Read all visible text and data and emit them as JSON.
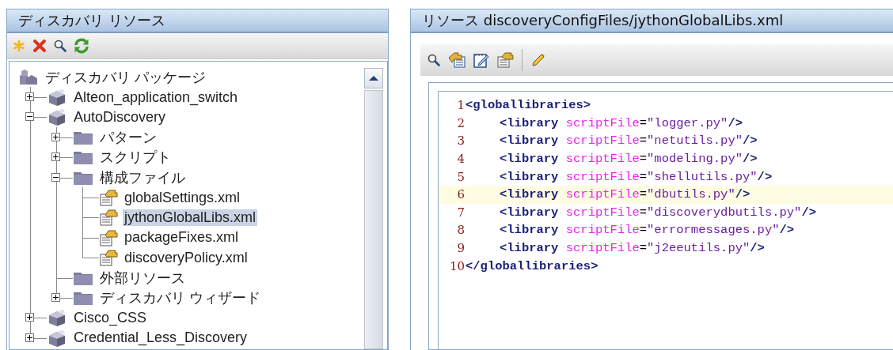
{
  "left_panel": {
    "title": "ディスカバリ リソース",
    "toolbar": [
      {
        "kind": "new"
      },
      {
        "kind": "delete"
      },
      {
        "kind": "search"
      },
      {
        "kind": "refresh"
      }
    ],
    "tree": [
      {
        "label": "ディスカバリ パッケージ",
        "kind": "root",
        "selected": false,
        "children": [
          {
            "label": "Alteon_application_switch",
            "kind": "package",
            "selected": false,
            "expanded": false
          },
          {
            "label": "AutoDiscovery",
            "kind": "package",
            "selected": false,
            "expanded": true,
            "children": [
              {
                "label": "パターン",
                "kind": "folder",
                "selected": false,
                "expanded": false
              },
              {
                "label": "スクリプト",
                "kind": "folder",
                "selected": false,
                "expanded": false
              },
              {
                "label": "構成ファイル",
                "kind": "folder",
                "selected": false,
                "expanded": true,
                "children": [
                  {
                    "label": "globalSettings.xml",
                    "kind": "file",
                    "selected": false
                  },
                  {
                    "label": "jythonGlobalLibs.xml",
                    "kind": "file",
                    "selected": true
                  },
                  {
                    "label": "packageFixes.xml",
                    "kind": "file",
                    "selected": false
                  },
                  {
                    "label": "discoveryPolicy.xml",
                    "kind": "file",
                    "selected": false
                  }
                ]
              },
              {
                "label": "外部リソース",
                "kind": "folder",
                "selected": false
              },
              {
                "label": "ディスカバリ ウィザード",
                "kind": "folder",
                "selected": false,
                "expanded": false
              }
            ]
          },
          {
            "label": "Cisco_CSS",
            "kind": "package",
            "selected": false,
            "expanded": false
          },
          {
            "label": "Credential_Less_Discovery",
            "kind": "package",
            "selected": false,
            "expanded": false
          }
        ]
      }
    ]
  },
  "right_panel": {
    "title": "リソース discoveryConfigFiles/jythonGlobalLibs.xml",
    "toolbar": [
      {
        "kind": "search"
      },
      {
        "kind": "folder-hand"
      },
      {
        "kind": "notepad"
      },
      {
        "kind": "doc-hand"
      },
      {
        "kind": "separator"
      },
      {
        "kind": "pencil"
      }
    ],
    "code_lines": [
      {
        "number": "1",
        "kind": "open",
        "tag": "<globallibraries>",
        "highlighted": false
      },
      {
        "number": "2",
        "kind": "element",
        "tag": "<library",
        "attr": "scriptFile",
        "eq": "=",
        "value": "\"logger.py\"",
        "close": "/>",
        "highlighted": false
      },
      {
        "number": "3",
        "kind": "element",
        "tag": "<library",
        "attr": "scriptFile",
        "eq": "=",
        "value": "\"netutils.py\"",
        "close": "/>",
        "highlighted": false
      },
      {
        "number": "4",
        "kind": "element",
        "tag": "<library",
        "attr": "scriptFile",
        "eq": "=",
        "value": "\"modeling.py\"",
        "close": "/>",
        "highlighted": false
      },
      {
        "number": "5",
        "kind": "element",
        "tag": "<library",
        "attr": "scriptFile",
        "eq": "=",
        "value": "\"shellutils.py\"",
        "close": "/>",
        "highlighted": false
      },
      {
        "number": "6",
        "kind": "element",
        "tag": "<library",
        "attr": "scriptFile",
        "eq": "=",
        "value": "\"dbutils.py\"",
        "close": "/>",
        "highlighted": true
      },
      {
        "number": "7",
        "kind": "element",
        "tag": "<library",
        "attr": "scriptFile",
        "eq": "=",
        "value": "\"discoverydbutils.py\"",
        "close": "/>",
        "highlighted": false
      },
      {
        "number": "8",
        "kind": "element",
        "tag": "<library",
        "attr": "scriptFile",
        "eq": "=",
        "value": "\"errormessages.py\"",
        "close": "/>",
        "highlighted": false
      },
      {
        "number": "9",
        "kind": "element",
        "tag": "<library",
        "attr": "scriptFile",
        "eq": "=",
        "value": "\"j2eeutils.py\"",
        "close": "/>",
        "highlighted": false
      },
      {
        "number": "10",
        "kind": "open",
        "tag": "</globallibraries>",
        "highlighted": false
      }
    ]
  }
}
